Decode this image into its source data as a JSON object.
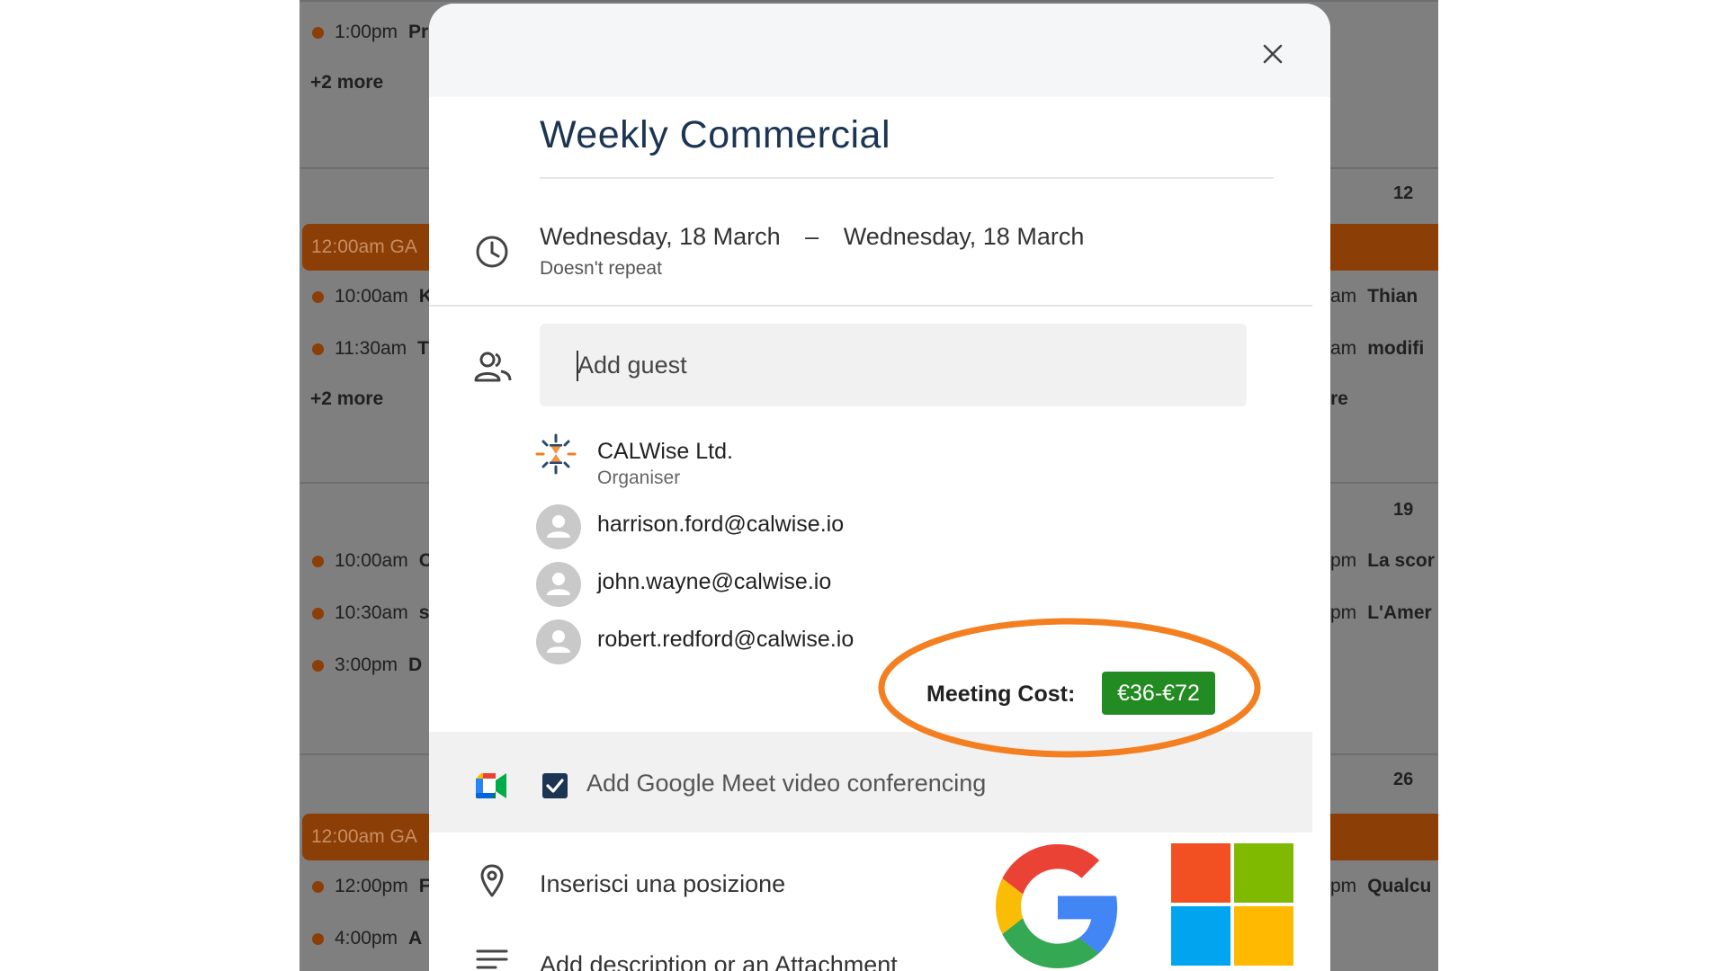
{
  "background_calendar": {
    "day_numbers": [
      "12",
      "19",
      "26"
    ],
    "left_column": [
      {
        "time": "1:00pm",
        "title": "Pr"
      },
      {
        "more": "+2 more"
      },
      {
        "bar": "12:00am GA"
      },
      {
        "time": "10:00am",
        "title": "K"
      },
      {
        "time": "11:30am",
        "title": "T"
      },
      {
        "more": "+2 more"
      },
      {
        "time": "10:00am",
        "title": "C"
      },
      {
        "time": "10:30am",
        "title": "s"
      },
      {
        "time": "3:00pm",
        "title": "D"
      },
      {
        "bar": "12:00am GA"
      },
      {
        "time": "12:00pm",
        "title": "F"
      },
      {
        "time": "4:00pm",
        "title": "A"
      }
    ],
    "right_column": [
      {
        "time": "am",
        "title": "Thian"
      },
      {
        "time": "am",
        "title": "modifi"
      },
      {
        "more": "re"
      },
      {
        "time": "pm",
        "title": "La scor"
      },
      {
        "time": "pm",
        "title": "L'Amer"
      },
      {
        "time": "pm",
        "title": "Qualcu"
      }
    ]
  },
  "modal": {
    "title": "Weekly Commercial",
    "start_date": "Wednesday, 18 March",
    "date_separator": "–",
    "end_date": "Wednesday, 18 March",
    "repeat": "Doesn't repeat",
    "guest_placeholder": "Add guest",
    "organiser": {
      "name": "CALWise Ltd.",
      "role": "Organiser"
    },
    "guests": [
      "harrison.ford@calwise.io",
      "john.wayne@calwise.io",
      "robert.redford@calwise.io"
    ],
    "meeting_cost_label": "Meeting Cost:",
    "meeting_cost_value": "€36-€72",
    "meet_label": "Add Google Meet video conferencing",
    "meet_checked": true,
    "location_placeholder": "Inserisci una posizione",
    "description_placeholder": "Add description or an Attachment"
  },
  "colors": {
    "title": "#1c3553",
    "cost_badge": "#228b22",
    "highlight_ring": "#f47f20",
    "calendar_event": "#8b3e06"
  },
  "icons": [
    "close-icon",
    "clock-icon",
    "people-icon",
    "calwise-logo",
    "user-avatar-icon",
    "google-meet-icon",
    "check-icon",
    "location-pin-icon",
    "description-lines-icon",
    "google-logo",
    "microsoft-logo"
  ]
}
